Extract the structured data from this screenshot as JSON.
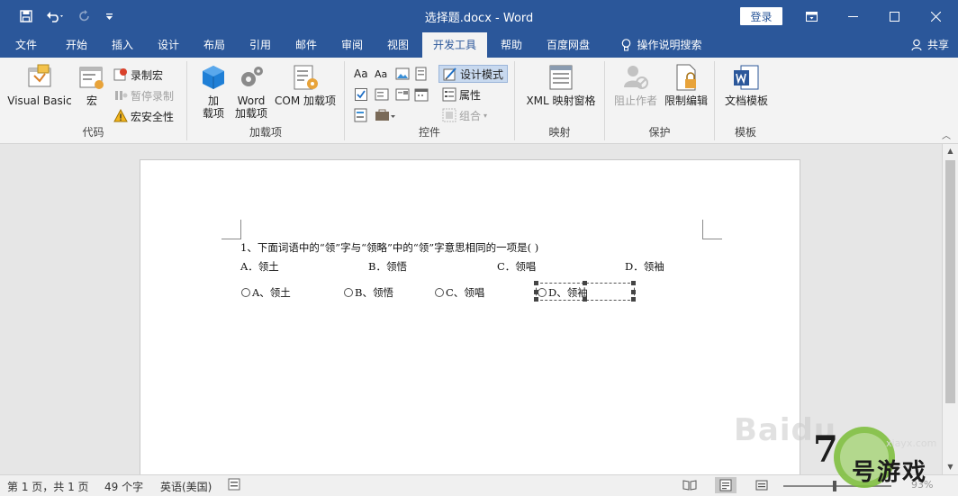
{
  "window": {
    "title": "选择题.docx - Word",
    "login_label": "登录",
    "qat": {
      "save_icon": "save-icon",
      "undo_icon": "undo-icon",
      "redo_icon": "redo-icon",
      "customize_icon": "customize-qat-icon"
    }
  },
  "tabs": [
    {
      "label": "文件"
    },
    {
      "label": "开始"
    },
    {
      "label": "插入"
    },
    {
      "label": "设计"
    },
    {
      "label": "布局"
    },
    {
      "label": "引用"
    },
    {
      "label": "邮件"
    },
    {
      "label": "审阅"
    },
    {
      "label": "视图"
    },
    {
      "label": "开发工具",
      "active": true
    },
    {
      "label": "帮助"
    },
    {
      "label": "百度网盘"
    },
    {
      "label": "操作说明搜索"
    }
  ],
  "share_label": "共享",
  "ribbon": {
    "code": {
      "label": "代码",
      "visual_basic": "Visual Basic",
      "macro": "宏",
      "record_macro": "录制宏",
      "pause_recording": "暂停录制",
      "macro_security": "宏安全性"
    },
    "addins": {
      "label": "加载项",
      "addins_line1": "加",
      "addins_line2": "载项",
      "word_addins_line1": "Word",
      "word_addins_line2": "加载项",
      "com_addins": "COM 加载项"
    },
    "controls": {
      "label": "控件",
      "design_mode": "设计模式",
      "properties": "属性",
      "group": "组合"
    },
    "mapping": {
      "label": "映射",
      "xml_pane": "XML 映射窗格"
    },
    "protect": {
      "label": "保护",
      "block_authors": "阻止作者",
      "restrict_editing": "限制编辑"
    },
    "templates": {
      "label": "模板",
      "document_template": "文档模板"
    }
  },
  "document": {
    "question": "1、下面词语中的“领”字与“领略”中的“领”字意思相同的一项是(      )",
    "options_text": [
      "A．领土",
      "B．领悟",
      "C．领唱",
      "D．领袖"
    ],
    "radio_options": [
      "A、领土",
      "B、领悟",
      "C、领唱",
      "D、领袖"
    ]
  },
  "status": {
    "page": "第 1 页，共 1 页",
    "words": "49 个字",
    "language": "英语(美国)",
    "zoom": "93%"
  },
  "watermark": {
    "baidu": "Baidu",
    "site": "xiayx.com",
    "brand_digit": "7",
    "brand": "号游戏"
  }
}
